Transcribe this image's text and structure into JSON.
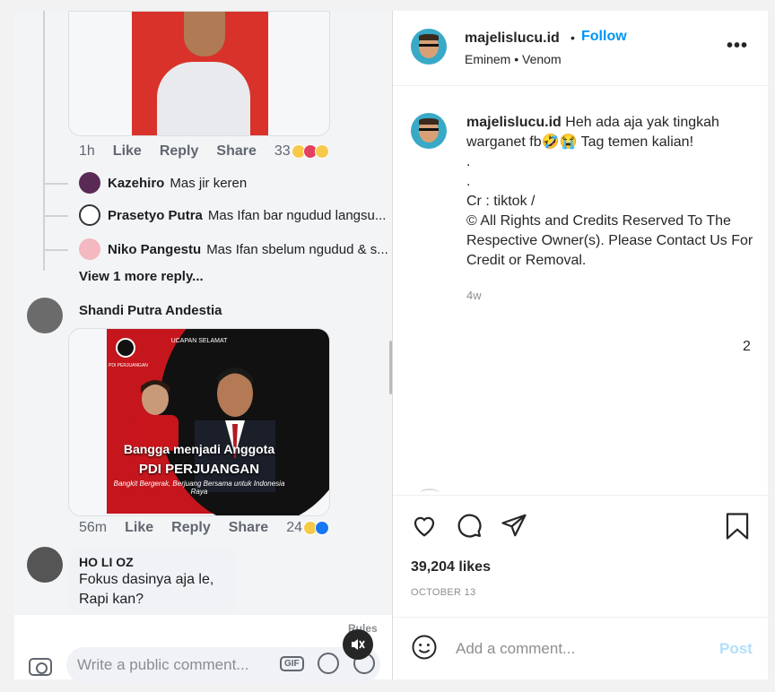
{
  "left_pane": {
    "comment1": {
      "time": "1h",
      "like": "Like",
      "reply": "Reply",
      "share": "Share",
      "reaction_count": "33"
    },
    "replies": [
      {
        "name": "Kazehiro",
        "text": "Mas jir keren"
      },
      {
        "name": "Prasetyo Putra",
        "text": "Mas Ifan bar ngudud langsu..."
      },
      {
        "name": "Niko Pangestu",
        "text": "Mas Ifan sbelum ngudud & s..."
      }
    ],
    "view_more": "View 1 more reply...",
    "comment2": {
      "name": "Shandi Putra Andestia",
      "poster_top": "UCAPAN SELAMAT",
      "poster_party_label": "PDI PERJUANGAN",
      "poster_line1": "Bangga menjadi Anggota",
      "poster_line2": "PDI PERJUANGAN",
      "poster_line3": "Bangkit Bergerak, Berjuang Bersama untuk Indonesia Raya",
      "time": "56m",
      "like": "Like",
      "reply": "Reply",
      "share": "Share",
      "reaction_count": "24"
    },
    "comment3": {
      "name": "HO LI OZ",
      "text_line1": "Fokus dasinya aja le,",
      "text_line2": "Rapi kan?"
    },
    "rules": "Rules",
    "input_placeholder": "Write a public comment...",
    "gif_label": "GIF"
  },
  "post": {
    "username": "majelislucu.id",
    "separator": "•",
    "follow": "Follow",
    "audio": "Eminem • Venom",
    "caption_user": "majelislucu.id",
    "caption_line1": "Heh ada aja yak tingkah",
    "caption_line2": "warganet fb🤣😭 Tag temen kalian!",
    "caption_dot1": ".",
    "caption_dot2": ".",
    "caption_cr": "Cr : tiktok /",
    "caption_rights": "© All Rights and Credits Reserved To The Respective Owner(s). Please Contact Us For Credit or Removal.",
    "age": "4w",
    "stray_number": "2",
    "likes": "39,204 likes",
    "date": "OCTOBER 13",
    "comment_placeholder": "Add a comment...",
    "post_button": "Post"
  },
  "colors": {
    "accent": "#0095f6",
    "post_disabled": "#b2dffc",
    "muted": "#8e8e8e"
  },
  "icons": [
    "heart-icon",
    "comment-icon",
    "share-icon",
    "bookmark-icon",
    "emoji-icon",
    "more-options-icon",
    "mute-icon",
    "camera-icon",
    "sticker-icon"
  ]
}
